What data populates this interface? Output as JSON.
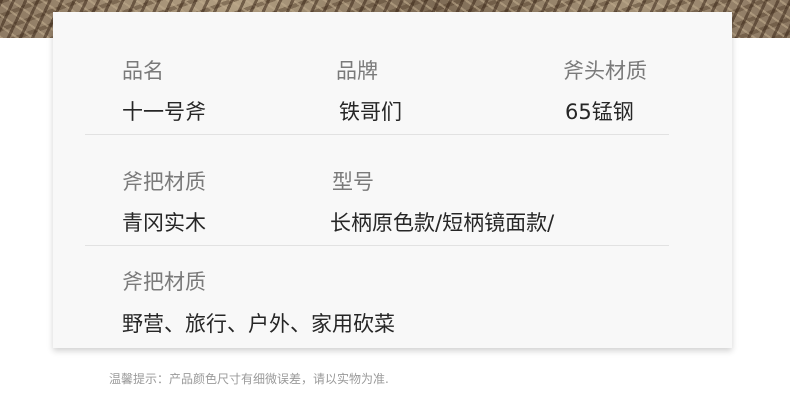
{
  "spec_table": {
    "row1": {
      "col1": {
        "label": "品名",
        "value": "十一号斧"
      },
      "col2": {
        "label": "品牌",
        "value": "铁哥们"
      },
      "col3": {
        "label": "斧头材质",
        "value": "65锰钢"
      }
    },
    "row2": {
      "col1": {
        "label": "斧把材质",
        "value": "青冈实木"
      },
      "col2": {
        "label": "型号",
        "value": "长柄原色款/短柄镜面款/"
      }
    },
    "row3": {
      "col1": {
        "label": "斧把材质",
        "value": "野营、旅行、户外、家用砍菜"
      }
    }
  },
  "footer": {
    "note": "温馨提示：产品颜色尺寸有细微误差，请以实物为准."
  }
}
